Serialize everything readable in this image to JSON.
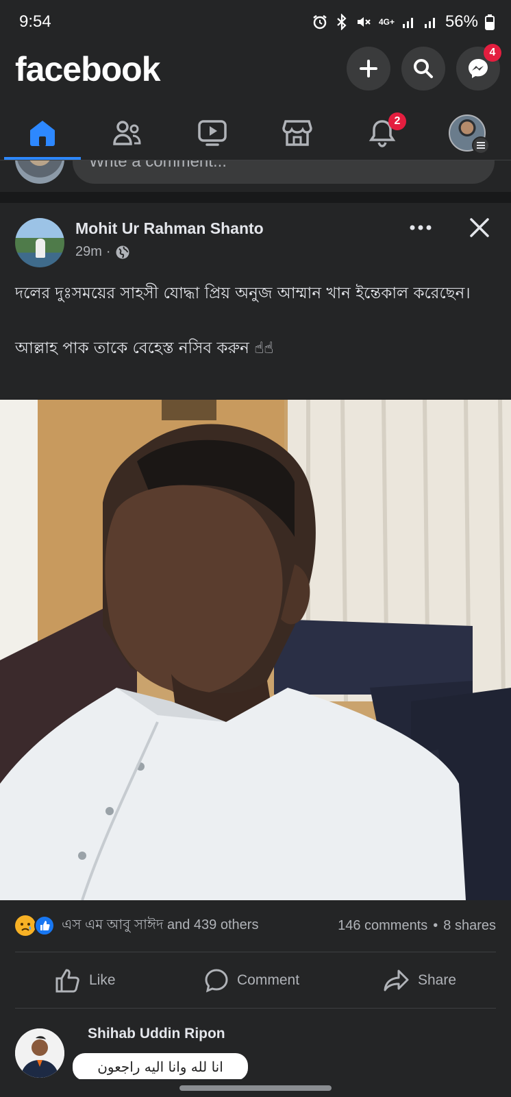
{
  "status_bar": {
    "time": "9:54",
    "network": "4G+",
    "battery": "56%"
  },
  "header": {
    "logo": "facebook",
    "messenger_badge": "4"
  },
  "nav": {
    "notifications_badge": "2"
  },
  "previous_post": {
    "comment_placeholder": "Write a comment..."
  },
  "post": {
    "author": "Mohit Ur Rahman Shanto",
    "time": "29m",
    "separator": "·",
    "text_line1": "দলের দুঃসময়ের সাহসী যোদ্ধা প্রিয় অনুজ আম্মান খান ইন্তেকাল করেছেন।",
    "text_line2": "আল্লাহ পাক তাকে বেহেস্ত নসিব করুন ☝☝",
    "reactions_summary": "এস এম আবু সাঈদ and 439 others",
    "comments_count": "146 comments",
    "dot": "•",
    "shares_count": "8 shares",
    "actions": {
      "like": "Like",
      "comment": "Comment",
      "share": "Share"
    }
  },
  "comment": {
    "author": "Shihab Uddin Ripon",
    "image_text": "انا لله وانا اليه راجعون"
  },
  "colors": {
    "background": "#18191a",
    "surface": "#242526",
    "accent": "#2d88ff",
    "badge": "#e41e3f"
  }
}
